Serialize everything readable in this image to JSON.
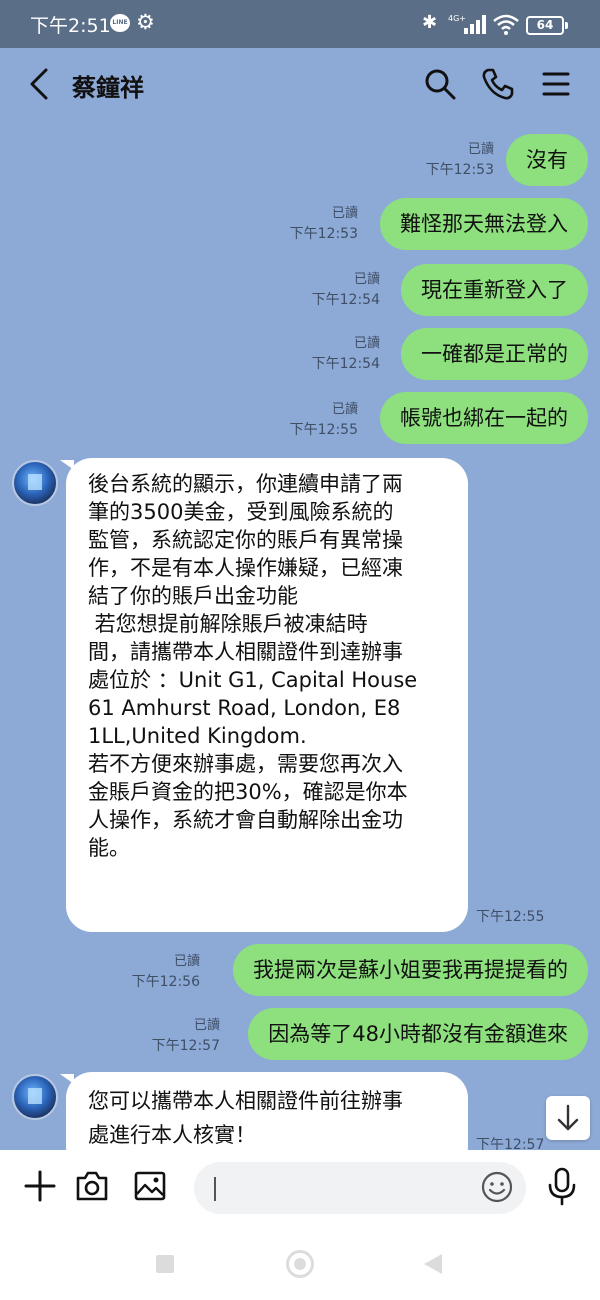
{
  "status_bar": {
    "time": "下午2:51",
    "line_badge": "LINE",
    "network": "4G+",
    "battery": "64"
  },
  "header": {
    "contact_name": "蔡鐘祥"
  },
  "messages_out": [
    {
      "text": "沒有",
      "read": "已讀",
      "time": "下午12:53"
    },
    {
      "text": "難怪那天無法登入",
      "read": "已讀",
      "time": "下午12:53"
    },
    {
      "text": "現在重新登入了",
      "read": "已讀",
      "time": "下午12:54"
    },
    {
      "text": "一確都是正常的",
      "read": "已讀",
      "time": "下午12:54"
    },
    {
      "text": "帳號也綁在一起的",
      "read": "已讀",
      "time": "下午12:55"
    },
    {
      "text": "我提兩次是蘇小姐要我再提提看的",
      "read": "已讀",
      "time": "下午12:56"
    },
    {
      "text": "因為等了48小時都沒有金額進來",
      "read": "已讀",
      "time": "下午12:57"
    }
  ],
  "messages_in": [
    {
      "lines": [
        "後台系統的顯示，你連續申請了兩",
        "筆的3500美金，受到風險系統的",
        "監管，系統認定你的賬戶有異常操",
        "作，不是有本人操作嫌疑，已經凍",
        "結了你的賬戶出金功能",
        " 若您想提前解除賬戶被凍結時",
        "間，請攜帶本人相關證件到達辦事",
        "處位於 ：Unit G1, Capital House",
        "61 Amhurst Road, London, E8",
        "1LL,United Kingdom.",
        "若不方便來辦事處，需要您再次入",
        "金賬戶資金的把30%，確認是你本",
        "人操作，系統才會自動解除出金功",
        "能。"
      ],
      "time": "下午12:55"
    },
    {
      "lines": [
        "您可以攜帶本人相關證件前往辦事",
        "處進行本人核實！"
      ],
      "time": "下午12:57"
    }
  ],
  "input": {
    "value": ""
  },
  "colors": {
    "chat_background": "#8DA9D6",
    "outgoing_bubble": "#8DE07D",
    "incoming_bubble": "#FFFFFF",
    "status_bar": "#5B6E88"
  },
  "icons": [
    "back-arrow-icon",
    "search-icon",
    "phone-icon",
    "menu-icon",
    "plus-icon",
    "camera-icon",
    "image-icon",
    "emoji-icon",
    "mic-icon",
    "arrow-down-icon"
  ]
}
